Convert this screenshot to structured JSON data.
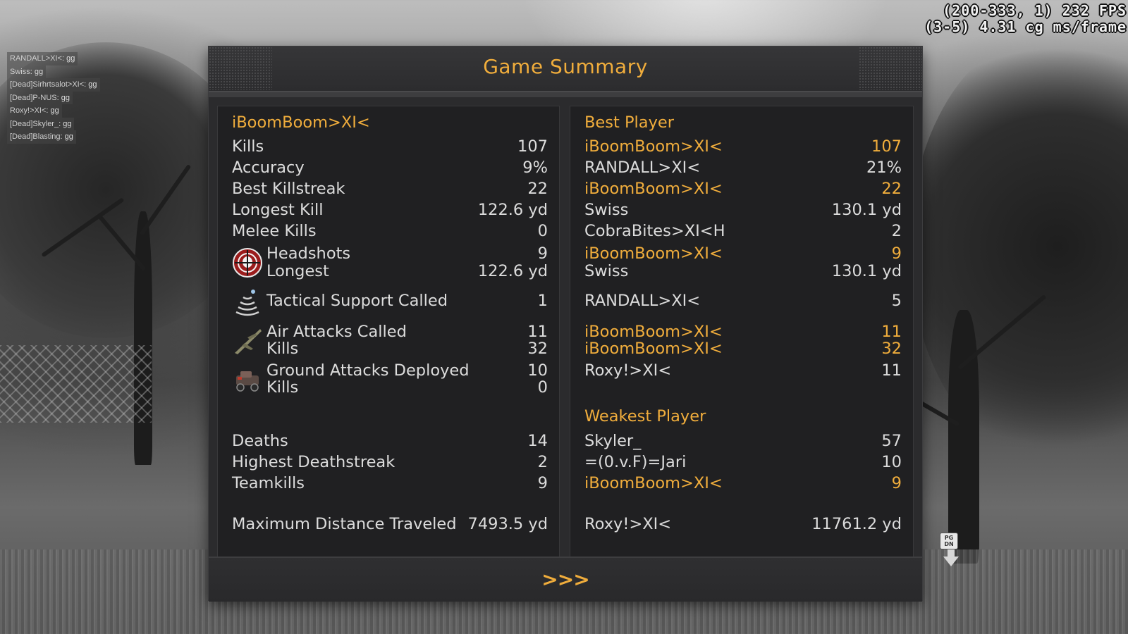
{
  "hud": {
    "fps_line1": "(200-333, 1) 232 FPS",
    "fps_line2": "(3-5) 4.31 cg ms/frame",
    "pgdn_label": "PG DN"
  },
  "chat": [
    {
      "name": "RANDALL>XI<",
      "msg": ": gg"
    },
    {
      "name": "Swiss",
      "msg": ": gg"
    },
    {
      "name": "[Dead]Sirhrtsalot>XI<",
      "msg": ": gg"
    },
    {
      "name": "[Dead]P-NUS",
      "msg": ": gg"
    },
    {
      "name": "Roxy!>XI<",
      "msg": ": gg"
    },
    {
      "name": "[Dead]Skyler_",
      "msg": ": gg"
    },
    {
      "name": "[Dead]Blasting",
      "msg": ": gg"
    }
  ],
  "panel": {
    "title": "Game Summary",
    "next_label": ">>>"
  },
  "left": {
    "player_name": "iBoomBoom>XI<",
    "kills_label": "Kills",
    "kills": "107",
    "accuracy_label": "Accuracy",
    "accuracy": "9%",
    "best_killstreak_label": "Best Killstreak",
    "best_killstreak": "22",
    "longest_kill_label": "Longest Kill",
    "longest_kill": "122.6 yd",
    "melee_label": "Melee Kills",
    "melee": "0",
    "headshots_label": "Headshots",
    "headshots": "9",
    "hs_longest_label": "Longest",
    "hs_longest": "122.6 yd",
    "tactical_label": "Tactical Support Called",
    "tactical": "1",
    "air_label": "Air Attacks Called",
    "air": "11",
    "air_kills_label": "Kills",
    "air_kills": "32",
    "ground_label": "Ground Attacks Deployed",
    "ground": "10",
    "ground_kills_label": "Kills",
    "ground_kills": "0",
    "deaths_label": "Deaths",
    "deaths": "14",
    "deathstreak_label": "Highest Deathstreak",
    "deathstreak": "2",
    "teamkills_label": "Teamkills",
    "teamkills": "9",
    "distance_label": "Maximum Distance Traveled",
    "distance": "7493.5 yd"
  },
  "right": {
    "best_header": "Best Player",
    "best": [
      {
        "name": "iBoomBoom>XI<",
        "value": "107"
      },
      {
        "name": "RANDALL>XI<",
        "value": "21%"
      },
      {
        "name": "iBoomBoom>XI<",
        "value": "22"
      },
      {
        "name": "Swiss",
        "value": "130.1 yd"
      },
      {
        "name": "CobraBites>XI<H",
        "value": "2"
      },
      {
        "name": "iBoomBoom>XI<",
        "value": "9"
      },
      {
        "name": "Swiss",
        "value": "130.1 yd"
      },
      {
        "name": "RANDALL>XI<",
        "value": "5"
      },
      {
        "name": "iBoomBoom>XI<",
        "value": "11"
      },
      {
        "name": "iBoomBoom>XI<",
        "value": "32"
      },
      {
        "name": "Roxy!>XI<",
        "value": "11"
      }
    ],
    "weakest_header": "Weakest Player",
    "weakest": [
      {
        "name": "Skyler_",
        "value": "57"
      },
      {
        "name": "=(0.v.F)=Jari",
        "value": "10"
      },
      {
        "name": "iBoomBoom>XI<",
        "value": "9"
      }
    ],
    "distance_name": "Roxy!>XI<",
    "distance_value": "11761.2 yd"
  },
  "colors": {
    "accent": "#f0ad3c",
    "panel_bg": "#2b2b2d",
    "column_bg": "#202022",
    "text": "#dcdcdc"
  },
  "icons": {
    "headshots": "crosshair-skull-icon",
    "tactical": "radar-icon",
    "air": "aircraft-icon",
    "ground": "vehicle-icon"
  }
}
